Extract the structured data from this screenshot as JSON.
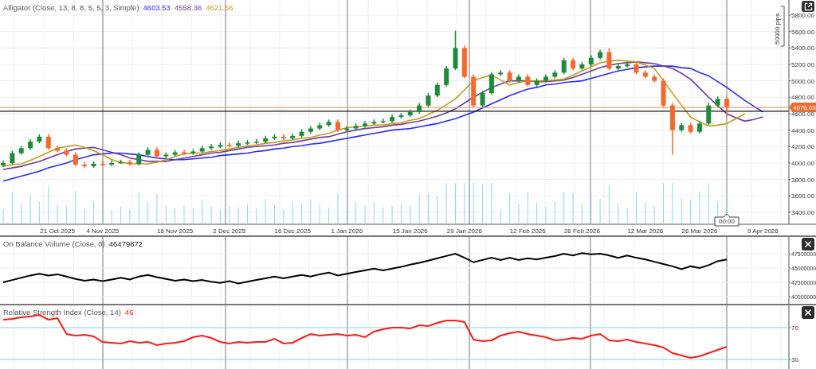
{
  "main_panel": {
    "legend": {
      "label": "Alligator (Close, 13, 8, 8, 5, 5, 3, Simple)",
      "values": [
        {
          "text": "4603.53"
        },
        {
          "text": "4558.36"
        },
        {
          "text": "4621.56"
        }
      ]
    },
    "scale_label": "50000 pips",
    "current_price": "4676.05",
    "crosshair_time": "00:00",
    "chart_data": {
      "type": "candlestick",
      "grid": true,
      "ylim": [
        3254,
        5984
      ],
      "ref_lines": [
        {
          "axis": "y",
          "value": 4676.05,
          "color": "#f5875a"
        },
        {
          "axis": "y",
          "value": 4630,
          "color": "#111111"
        }
      ],
      "yticks": [
        {
          "value": 5800,
          "label": "5800.00"
        },
        {
          "value": 5600,
          "label": "5600.00"
        },
        {
          "value": 5400,
          "label": "5400.00"
        },
        {
          "value": 5200,
          "label": "5200.00"
        },
        {
          "value": 5000,
          "label": "5000.00"
        },
        {
          "value": 4800,
          "label": "4800.00"
        },
        {
          "value": 4600,
          "label": "4600.00"
        },
        {
          "value": 4400,
          "label": "4400.00"
        },
        {
          "value": 4200,
          "label": "4200.00"
        },
        {
          "value": 4000,
          "label": "4000.00"
        },
        {
          "value": 3800,
          "label": "3800.00"
        },
        {
          "value": 3600,
          "label": "3600.00"
        },
        {
          "value": 3400,
          "label": "3400.00"
        }
      ],
      "categories": [
        null,
        null,
        null,
        null,
        null,
        null,
        "21 Oct 2025",
        null,
        null,
        null,
        null,
        "4 Nov 2025",
        null,
        null,
        null,
        null,
        null,
        null,
        null,
        "18 Nov 2025",
        null,
        null,
        null,
        null,
        null,
        "2 Dec 2025",
        null,
        null,
        null,
        null,
        null,
        null,
        "16 Dec 2025",
        null,
        null,
        null,
        null,
        null,
        "1 Jan 2026",
        null,
        null,
        null,
        null,
        null,
        null,
        "15 Jan 2026",
        null,
        null,
        null,
        null,
        null,
        "29 Jan 2026",
        null,
        null,
        null,
        null,
        null,
        null,
        "12 Feb 2026",
        null,
        null,
        null,
        null,
        null,
        "26 Feb 2026",
        null,
        null,
        null,
        null,
        null,
        null,
        "12 Mar 2026",
        null,
        null,
        null,
        null,
        null,
        "26 Mar 2026",
        null,
        null,
        null,
        null,
        null,
        null,
        "9 Apr 2026"
      ],
      "ohlc": [
        [
          3970,
          4030,
          3950,
          4000
        ],
        [
          4000,
          4150,
          3980,
          4120
        ],
        [
          4120,
          4210,
          4100,
          4180
        ],
        [
          4180,
          4290,
          4160,
          4260
        ],
        [
          4260,
          4350,
          4240,
          4320
        ],
        [
          4320,
          4350,
          4160,
          4180
        ],
        [
          4180,
          4210,
          4130,
          4150
        ],
        [
          4150,
          4180,
          4080,
          4100
        ],
        [
          4100,
          4130,
          3960,
          3980
        ],
        [
          3980,
          4010,
          3940,
          3960
        ],
        [
          3960,
          4020,
          3940,
          3990
        ],
        [
          3990,
          4020,
          3960,
          3980
        ],
        [
          3980,
          4030,
          3960,
          4000
        ],
        [
          4000,
          4040,
          3990,
          4010
        ],
        [
          4010,
          4040,
          3970,
          3990
        ],
        [
          3990,
          4130,
          3970,
          4100
        ],
        [
          4100,
          4190,
          4080,
          4160
        ],
        [
          4160,
          4190,
          4060,
          4080
        ],
        [
          4080,
          4130,
          4060,
          4100
        ],
        [
          4100,
          4160,
          4080,
          4130
        ],
        [
          4130,
          4160,
          4100,
          4120
        ],
        [
          4120,
          4170,
          4100,
          4140
        ],
        [
          4140,
          4210,
          4120,
          4180
        ],
        [
          4180,
          4230,
          4160,
          4200
        ],
        [
          4200,
          4250,
          4180,
          4220
        ],
        [
          4220,
          4250,
          4190,
          4210
        ],
        [
          4210,
          4270,
          4190,
          4240
        ],
        [
          4240,
          4280,
          4220,
          4250
        ],
        [
          4250,
          4290,
          4230,
          4260
        ],
        [
          4260,
          4330,
          4240,
          4300
        ],
        [
          4300,
          4350,
          4280,
          4320
        ],
        [
          4320,
          4350,
          4280,
          4300
        ],
        [
          4300,
          4360,
          4280,
          4330
        ],
        [
          4330,
          4410,
          4310,
          4380
        ],
        [
          4380,
          4450,
          4360,
          4420
        ],
        [
          4420,
          4490,
          4400,
          4460
        ],
        [
          4460,
          4530,
          4440,
          4500
        ],
        [
          4500,
          4530,
          4380,
          4400
        ],
        [
          4400,
          4450,
          4380,
          4420
        ],
        [
          4420,
          4480,
          4400,
          4450
        ],
        [
          4450,
          4510,
          4430,
          4480
        ],
        [
          4480,
          4530,
          4460,
          4500
        ],
        [
          4500,
          4540,
          4480,
          4510
        ],
        [
          4510,
          4590,
          4490,
          4560
        ],
        [
          4560,
          4610,
          4540,
          4580
        ],
        [
          4580,
          4650,
          4560,
          4620
        ],
        [
          4620,
          4730,
          4600,
          4700
        ],
        [
          4700,
          4850,
          4680,
          4820
        ],
        [
          4820,
          4980,
          4800,
          4950
        ],
        [
          4950,
          5180,
          4930,
          5150
        ],
        [
          5150,
          5610,
          5130,
          5400
        ],
        [
          5400,
          5430,
          5030,
          5050
        ],
        [
          5050,
          5080,
          4680,
          4700
        ],
        [
          4700,
          4880,
          4680,
          4850
        ],
        [
          4850,
          5110,
          4830,
          5080
        ],
        [
          5080,
          5130,
          5060,
          5100
        ],
        [
          5100,
          5130,
          4980,
          5000
        ],
        [
          5000,
          5080,
          4980,
          5050
        ],
        [
          5050,
          5080,
          4930,
          4950
        ],
        [
          4950,
          5030,
          4930,
          5000
        ],
        [
          5000,
          5080,
          4980,
          5050
        ],
        [
          5050,
          5130,
          5030,
          5100
        ],
        [
          5100,
          5280,
          5080,
          5250
        ],
        [
          5250,
          5280,
          5130,
          5150
        ],
        [
          5150,
          5230,
          5130,
          5200
        ],
        [
          5200,
          5310,
          5180,
          5280
        ],
        [
          5280,
          5380,
          5260,
          5350
        ],
        [
          5350,
          5400,
          5130,
          5150
        ],
        [
          5150,
          5210,
          5130,
          5180
        ],
        [
          5180,
          5230,
          5160,
          5200
        ],
        [
          5200,
          5230,
          5080,
          5100
        ],
        [
          5100,
          5130,
          5030,
          5050
        ],
        [
          5050,
          5080,
          4980,
          5000
        ],
        [
          5000,
          5030,
          4680,
          4700
        ],
        [
          4700,
          4730,
          4100,
          4400
        ],
        [
          4400,
          4490,
          4380,
          4460
        ],
        [
          4460,
          4490,
          4360,
          4380
        ],
        [
          4380,
          4510,
          4360,
          4480
        ],
        [
          4480,
          4730,
          4460,
          4700
        ],
        [
          4700,
          4810,
          4680,
          4780
        ],
        [
          4780,
          4800,
          4560,
          4680
        ],
        null,
        null,
        null,
        null
      ],
      "series": [
        {
          "type": "line",
          "color": "#2b2bf5",
          "values": [
            3780,
            3810,
            3840,
            3870,
            3900,
            3940,
            3970,
            4000,
            4040,
            4070,
            4100,
            4110,
            4120,
            4120,
            4110,
            4100,
            4080,
            4060,
            4050,
            4040,
            4040,
            4050,
            4060,
            4070,
            4090,
            4100,
            4110,
            4120,
            4140,
            4150,
            4170,
            4180,
            4200,
            4210,
            4230,
            4240,
            4260,
            4280,
            4300,
            4320,
            4340,
            4360,
            4380,
            4400,
            4410,
            4420,
            4440,
            4460,
            4480,
            4510,
            4540,
            4580,
            4620,
            4670,
            4720,
            4770,
            4820,
            4860,
            4900,
            4920,
            4950,
            4960,
            4980,
            4990,
            5000,
            5030,
            5060,
            5090,
            5120,
            5140,
            5160,
            5170,
            5180,
            5180,
            5180,
            5160,
            5150,
            5100,
            5060,
            4990,
            4920,
            4840,
            4760,
            4690,
            4620
          ]
        },
        {
          "type": "line",
          "color": "#6e3d96",
          "values": [
            3920,
            3940,
            3960,
            3990,
            4020,
            4060,
            4100,
            4140,
            4170,
            4180,
            4190,
            4160,
            4130,
            4100,
            4060,
            4040,
            4020,
            4020,
            4020,
            4040,
            4060,
            4080,
            4100,
            4120,
            4130,
            4150,
            4170,
            4190,
            4200,
            4210,
            4220,
            4240,
            4250,
            4270,
            4290,
            4310,
            4320,
            4350,
            4380,
            4400,
            4420,
            4430,
            4440,
            4460,
            4470,
            4490,
            4510,
            4540,
            4570,
            4610,
            4660,
            4730,
            4800,
            4860,
            4920,
            4960,
            5000,
            5000,
            5000,
            4990,
            4990,
            5000,
            5010,
            5040,
            5080,
            5120,
            5160,
            5190,
            5210,
            5220,
            5230,
            5220,
            5210,
            5180,
            5150,
            5090,
            5020,
            4910,
            4800,
            4700,
            4600,
            4550,
            4510,
            4530,
            4560
          ]
        },
        {
          "type": "line",
          "color": "#c39a1e",
          "values": [
            3960,
            3980,
            3990,
            4030,
            4080,
            4130,
            4180,
            4200,
            4220,
            4190,
            4150,
            4100,
            4040,
            4010,
            3990,
            3990,
            3990,
            4010,
            4040,
            4080,
            4110,
            4120,
            4120,
            4140,
            4150,
            4170,
            4190,
            4210,
            4220,
            4240,
            4250,
            4270,
            4280,
            4300,
            4310,
            4340,
            4360,
            4400,
            4430,
            4440,
            4450,
            4460,
            4460,
            4480,
            4490,
            4520,
            4540,
            4590,
            4640,
            4710,
            4780,
            4890,
            5000,
            5040,
            5070,
            5010,
            4950,
            4980,
            5000,
            5000,
            5000,
            5010,
            5020,
            5070,
            5120,
            5170,
            5220,
            5240,
            5250,
            5240,
            5230,
            5190,
            5150,
            5000,
            4850,
            4700,
            4560,
            4500,
            4450,
            4460,
            4480,
            4540,
            4600,
            null,
            null
          ]
        }
      ]
    }
  },
  "obv_panel": {
    "legend": {
      "label": "On Balance Volume (Close, 0)",
      "value": "46479872"
    },
    "chart_data": {
      "type": "line",
      "grid": true,
      "ylim": [
        38750000,
        50700000
      ],
      "yticks": [
        {
          "value": 47500000,
          "label": "47500000"
        },
        {
          "value": 45000000,
          "label": "45000000"
        },
        {
          "value": 42500000,
          "label": "42500000"
        },
        {
          "value": 40000000,
          "label": "40000000"
        }
      ],
      "series": [
        {
          "color": "#000000",
          "values": [
            42500000,
            42900000,
            43300000,
            43700000,
            44000000,
            43700000,
            43900000,
            43500000,
            43100000,
            42800000,
            43000000,
            42700000,
            43000000,
            43300000,
            43000000,
            43500000,
            43800000,
            43400000,
            43100000,
            42800000,
            43000000,
            42700000,
            42900000,
            42600000,
            42400000,
            42700000,
            42300000,
            42600000,
            42900000,
            43200000,
            43500000,
            43200000,
            43500000,
            43800000,
            43500000,
            43900000,
            44200000,
            43700000,
            44000000,
            44300000,
            44600000,
            44900000,
            44600000,
            44900000,
            45200000,
            45600000,
            45900000,
            46300000,
            46700000,
            47100000,
            47500000,
            46800000,
            46000000,
            46400000,
            46800000,
            46400000,
            46800000,
            46400000,
            46700000,
            46500000,
            46800000,
            47100000,
            47500000,
            47200000,
            47600000,
            47400000,
            47500000,
            47200000,
            46800000,
            47200000,
            46800000,
            46500000,
            46100000,
            45700000,
            45300000,
            44800000,
            45300000,
            45000000,
            45500000,
            46200000,
            46500000
          ]
        }
      ]
    }
  },
  "rsi_panel": {
    "legend": {
      "label": "Relative Strength Index (Close, 14)",
      "value": "46"
    },
    "chart_data": {
      "type": "line",
      "grid": true,
      "ylim": [
        18,
        100
      ],
      "yticks": [
        {
          "value": 70,
          "label": "70"
        },
        {
          "value": 30,
          "label": "30"
        }
      ],
      "series": [
        {
          "color": "#ff1a1a",
          "values": [
            80,
            81,
            83,
            84,
            86,
            80,
            82,
            62,
            60,
            61,
            59,
            52,
            51,
            50,
            53,
            51,
            52,
            48,
            50,
            51,
            53,
            58,
            60,
            57,
            52,
            50,
            52,
            51,
            52,
            52,
            56,
            50,
            51,
            57,
            62,
            60,
            61,
            62,
            60,
            61,
            58,
            65,
            68,
            70,
            70,
            69,
            73,
            72,
            76,
            79,
            79,
            77,
            55,
            53,
            54,
            60,
            63,
            65,
            62,
            60,
            58,
            54,
            55,
            57,
            56,
            60,
            62,
            54,
            53,
            55,
            52,
            50,
            48,
            45,
            38,
            35,
            32,
            34,
            38,
            42,
            46
          ]
        }
      ]
    }
  }
}
